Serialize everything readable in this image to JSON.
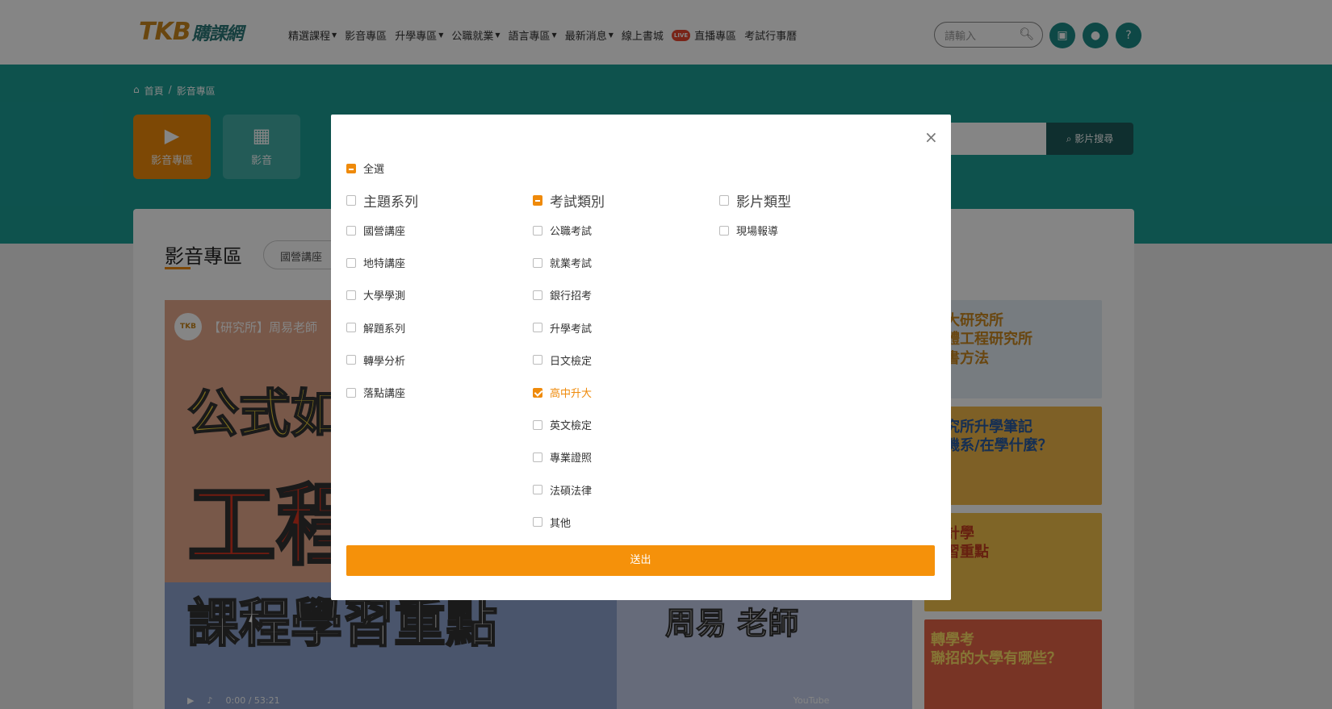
{
  "header": {
    "logo_mark": "TKB",
    "logo_text": "購課網",
    "nav": [
      {
        "label": "精選課程",
        "dropdown": true
      },
      {
        "label": "影音專區",
        "dropdown": false
      },
      {
        "label": "升學專區",
        "dropdown": true
      },
      {
        "label": "公職就業",
        "dropdown": true
      },
      {
        "label": "語言專區",
        "dropdown": true
      },
      {
        "label": "最新消息",
        "dropdown": true
      },
      {
        "label": "線上書城",
        "dropdown": false
      },
      {
        "label": "直播專區",
        "dropdown": false,
        "badge": "LIVE"
      },
      {
        "label": "考試行事曆",
        "dropdown": false
      }
    ],
    "search_placeholder": "請輸入",
    "icons": [
      "cart-icon",
      "user-icon",
      "help-icon"
    ],
    "help_glyph": "?"
  },
  "breadcrumb": {
    "home": "首頁",
    "separator": "/",
    "current": "影音專區"
  },
  "hero": {
    "tiles": [
      {
        "label": "影音專區",
        "icon": "video-camera-icon",
        "active": true
      },
      {
        "label": "影音",
        "icon": "film-icon",
        "active": false
      }
    ],
    "video_search_button": "影片搜尋"
  },
  "content": {
    "section_title": "影音專區",
    "filter_pill": "國營講座",
    "video": {
      "title": "【研究所】周易老師",
      "channel_mark": "TKB",
      "headline_1": "公式如",
      "headline_2": "工程",
      "headline_3": "課程學習重點",
      "teacher": "周易 老師",
      "time": "0:00 / 53:21",
      "brand": "YouTube"
    },
    "thumbnails": [
      {
        "text": "交大研究所\n媒體工程研究所\n選書方法"
      },
      {
        "text": "研究所升學筆記\n電機系/在學什麼？"
      },
      {
        "text": "統計學\n學習重點"
      },
      {
        "text": "轉學考\n聯招的大學有哪些？"
      }
    ]
  },
  "modal": {
    "select_all": {
      "label": "全選",
      "state": "partial"
    },
    "columns": [
      {
        "group": {
          "label": "主題系列",
          "state": "unchecked"
        },
        "items": [
          {
            "label": "國營講座",
            "state": "unchecked"
          },
          {
            "label": "地特講座",
            "state": "unchecked"
          },
          {
            "label": "大學學測",
            "state": "unchecked"
          },
          {
            "label": "解題系列",
            "state": "unchecked"
          },
          {
            "label": "轉學分析",
            "state": "unchecked"
          },
          {
            "label": "落點講座",
            "state": "unchecked"
          }
        ]
      },
      {
        "group": {
          "label": "考試類別",
          "state": "partial"
        },
        "items": [
          {
            "label": "公職考試",
            "state": "unchecked"
          },
          {
            "label": "就業考試",
            "state": "unchecked"
          },
          {
            "label": "銀行招考",
            "state": "unchecked"
          },
          {
            "label": "升學考試",
            "state": "unchecked"
          },
          {
            "label": "日文檢定",
            "state": "unchecked"
          },
          {
            "label": "高中升大",
            "state": "checked"
          },
          {
            "label": "英文檢定",
            "state": "unchecked"
          },
          {
            "label": "專業證照",
            "state": "unchecked"
          },
          {
            "label": "法碩法律",
            "state": "unchecked"
          },
          {
            "label": "其他",
            "state": "unchecked"
          }
        ]
      },
      {
        "group": {
          "label": "影片類型",
          "state": "unchecked"
        },
        "items": [
          {
            "label": "現場報導",
            "state": "unchecked"
          }
        ]
      }
    ],
    "submit_label": "送出",
    "close_glyph": "×"
  },
  "colors": {
    "accent": "#ef8a0a",
    "teal": "#1b9e95",
    "teal_dark": "#1e5a5a"
  }
}
